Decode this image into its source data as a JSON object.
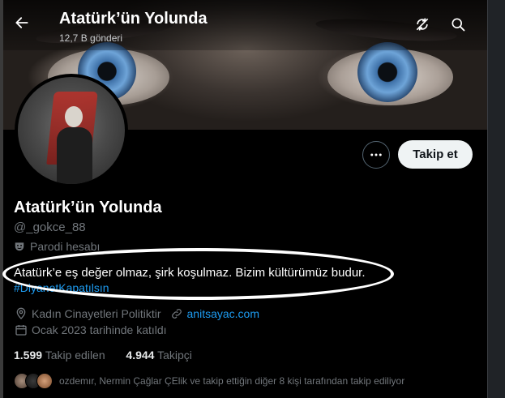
{
  "header": {
    "title": "Atatürk’ün Yolunda",
    "post_count": "12,7 B gönderi"
  },
  "icons": {
    "back": "arrow-left-icon",
    "refresh": "refresh-slash-icon",
    "search": "search-icon",
    "more": "more-horizontal-icon",
    "parody": "theater-mask-icon",
    "location": "location-pin-icon",
    "link": "link-icon",
    "calendar": "calendar-icon"
  },
  "actions": {
    "follow_label": "Takip et"
  },
  "profile": {
    "name": "Atatürk’ün Yolunda",
    "handle": "@_gokce_88",
    "parody_label": "Parodi hesabı",
    "bio": "Atatürk’e eş değer olmaz, şirk koşulmaz. Bizim kültürümüz budur.",
    "hashtag": "#DiyanetKapatılsın",
    "location": "Kadın Cinayetleri Politiktir",
    "website": "anitsayac.com",
    "joined": "Ocak 2023 tarihinde katıldı"
  },
  "stats": {
    "following_count": "1.599",
    "following_label": "Takip edilen",
    "followers_count": "4.944",
    "followers_label": "Takipçi"
  },
  "followed_by": {
    "text": "ozdemır, Nermin Çağlar ÇElik ve takip ettiğin diğer 8 kişi tarafından takip ediliyor"
  },
  "colors": {
    "background": "#000000",
    "text_primary": "#e7e9ea",
    "text_secondary": "#71767b",
    "link": "#1d9bf0",
    "follow_button_bg": "#eff3f4",
    "highlight_oval": "#ffffff"
  }
}
